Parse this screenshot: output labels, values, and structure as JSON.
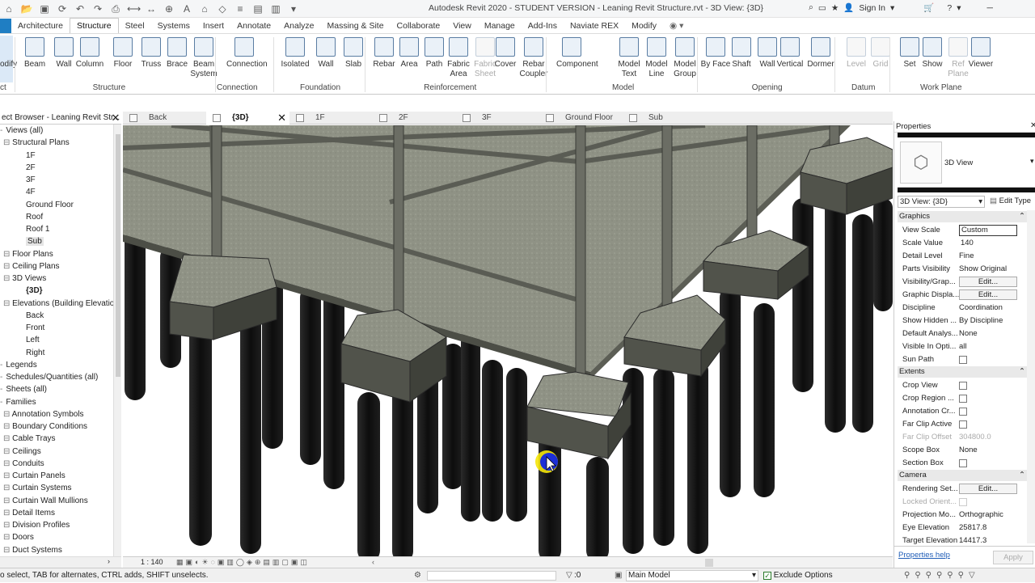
{
  "title_bar": {
    "app_title": "Autodesk Revit 2020 - STUDENT VERSION - Leaning Revit Structure.rvt - 3D View: {3D}",
    "sign_in": "Sign In"
  },
  "ribbon_tabs": [
    "",
    "Architecture",
    "Structure",
    "Steel",
    "Systems",
    "Insert",
    "Annotate",
    "Analyze",
    "Massing & Site",
    "Collaborate",
    "View",
    "Manage",
    "Add-Ins",
    "Naviate REX",
    "Modify"
  ],
  "ribbon": {
    "modify_label": "odify",
    "select_label": "ct",
    "structure": {
      "label": "Structure",
      "buttons": [
        "Beam",
        "Wall",
        "Column",
        "Floor",
        "Truss",
        "Brace",
        "Beam System"
      ]
    },
    "connection": {
      "label": "Connection",
      "buttons": [
        "Connection"
      ]
    },
    "foundation": {
      "label": "Foundation",
      "buttons": [
        "Isolated",
        "Wall",
        "Slab"
      ]
    },
    "reinforcement": {
      "label": "Reinforcement",
      "buttons": [
        "Rebar",
        "Area",
        "Path",
        "Fabric Area",
        "Fabric Sheet",
        "Cover",
        "Rebar Coupler"
      ]
    },
    "model": {
      "label": "Model",
      "buttons": [
        "Component",
        "Model Text",
        "Model Line",
        "Model Group"
      ]
    },
    "opening": {
      "label": "Opening",
      "buttons": [
        "By Face",
        "Shaft",
        "Wall",
        "Vertical",
        "Dormer"
      ]
    },
    "datum": {
      "label": "Datum",
      "buttons": [
        "Level",
        "Grid"
      ]
    },
    "work_plane": {
      "label": "Work Plane",
      "buttons": [
        "Set",
        "Show",
        "Ref Plane",
        "Viewer"
      ]
    }
  },
  "project_browser": {
    "title": "ect Browser - Leaning Revit Str...",
    "tree": [
      {
        "label": "Views (all)",
        "indent": 0
      },
      {
        "label": "Structural Plans",
        "indent": 1
      },
      {
        "label": "1F",
        "indent": 2
      },
      {
        "label": "2F",
        "indent": 2
      },
      {
        "label": "3F",
        "indent": 2
      },
      {
        "label": "4F",
        "indent": 2
      },
      {
        "label": "Ground Floor",
        "indent": 2
      },
      {
        "label": "Roof",
        "indent": 2
      },
      {
        "label": "Roof 1",
        "indent": 2
      },
      {
        "label": "Sub",
        "indent": 2,
        "selected": true
      },
      {
        "label": "Floor Plans",
        "indent": 1
      },
      {
        "label": "Ceiling Plans",
        "indent": 1
      },
      {
        "label": "3D Views",
        "indent": 1
      },
      {
        "label": "{3D}",
        "indent": 2,
        "bold": true
      },
      {
        "label": "Elevations (Building Elevation)",
        "indent": 1
      },
      {
        "label": "Back",
        "indent": 2
      },
      {
        "label": "Front",
        "indent": 2
      },
      {
        "label": "Left",
        "indent": 2
      },
      {
        "label": "Right",
        "indent": 2
      },
      {
        "label": "Legends",
        "indent": 0
      },
      {
        "label": "Schedules/Quantities (all)",
        "indent": 0
      },
      {
        "label": "Sheets (all)",
        "indent": 0
      },
      {
        "label": "Families",
        "indent": 0
      },
      {
        "label": "Annotation Symbols",
        "indent": 1
      },
      {
        "label": "Boundary Conditions",
        "indent": 1
      },
      {
        "label": "Cable Trays",
        "indent": 1
      },
      {
        "label": "Ceilings",
        "indent": 1
      },
      {
        "label": "Conduits",
        "indent": 1
      },
      {
        "label": "Curtain Panels",
        "indent": 1
      },
      {
        "label": "Curtain Systems",
        "indent": 1
      },
      {
        "label": "Curtain Wall Mullions",
        "indent": 1
      },
      {
        "label": "Detail Items",
        "indent": 1
      },
      {
        "label": "Division Profiles",
        "indent": 1
      },
      {
        "label": "Doors",
        "indent": 1
      },
      {
        "label": "Duct Systems",
        "indent": 1
      }
    ]
  },
  "view_tabs": [
    {
      "label": "Back",
      "active": false
    },
    {
      "label": "{3D}",
      "active": true
    },
    {
      "label": "1F",
      "active": false
    },
    {
      "label": "2F",
      "active": false
    },
    {
      "label": "3F",
      "active": false
    },
    {
      "label": "Ground Floor",
      "active": false
    },
    {
      "label": "Sub",
      "active": false
    }
  ],
  "view_bar": {
    "scale": "1 : 140"
  },
  "properties": {
    "title": "Properties",
    "type_name": "3D View",
    "view_selector": "3D View: {3D}",
    "edit_type": "Edit Type",
    "groups": [
      {
        "label": "Graphics",
        "rows": [
          {
            "key": "View Scale",
            "value": "Custom",
            "kind": "input"
          },
          {
            "key": "Scale Value",
            "value": "140",
            "prefix": "1:",
            "kind": "text"
          },
          {
            "key": "Detail Level",
            "value": "Fine",
            "kind": "text"
          },
          {
            "key": "Parts Visibility",
            "value": "Show Original",
            "kind": "text"
          },
          {
            "key": "Visibility/Grap...",
            "value": "Edit...",
            "kind": "button"
          },
          {
            "key": "Graphic Displa...",
            "value": "Edit...",
            "kind": "button"
          },
          {
            "key": "Discipline",
            "value": "Coordination",
            "kind": "text"
          },
          {
            "key": "Show Hidden ...",
            "value": "By Discipline",
            "kind": "text"
          },
          {
            "key": "Default Analys...",
            "value": "None",
            "kind": "text"
          },
          {
            "key": "Visible In Opti...",
            "value": "all",
            "kind": "text"
          },
          {
            "key": "Sun Path",
            "value": "",
            "kind": "checkbox"
          }
        ]
      },
      {
        "label": "Extents",
        "rows": [
          {
            "key": "Crop View",
            "value": "",
            "kind": "checkbox"
          },
          {
            "key": "Crop Region ...",
            "value": "",
            "kind": "checkbox"
          },
          {
            "key": "Annotation Cr...",
            "value": "",
            "kind": "checkbox"
          },
          {
            "key": "Far Clip Active",
            "value": "",
            "kind": "checkbox"
          },
          {
            "key": "Far Clip Offset",
            "value": "304800.0",
            "kind": "text",
            "dim": true
          },
          {
            "key": "Scope Box",
            "value": "None",
            "kind": "text"
          },
          {
            "key": "Section Box",
            "value": "",
            "kind": "checkbox"
          }
        ]
      },
      {
        "label": "Camera",
        "rows": [
          {
            "key": "Rendering Set...",
            "value": "Edit...",
            "kind": "button"
          },
          {
            "key": "Locked Orient...",
            "value": "",
            "kind": "checkbox",
            "dim": true
          },
          {
            "key": "Projection Mo...",
            "value": "Orthographic",
            "kind": "text"
          },
          {
            "key": "Eye Elevation",
            "value": "25817.8",
            "kind": "text"
          },
          {
            "key": "Target Elevation",
            "value": "14417.3",
            "kind": "text"
          }
        ]
      }
    ],
    "help_link": "Properties help",
    "apply": "Apply"
  },
  "status_bar": {
    "message": "o select, TAB for alternates, CTRL adds, SHIFT unselects.",
    "count": ":0",
    "model": "Main Model",
    "exclude_options": "Exclude Options"
  }
}
